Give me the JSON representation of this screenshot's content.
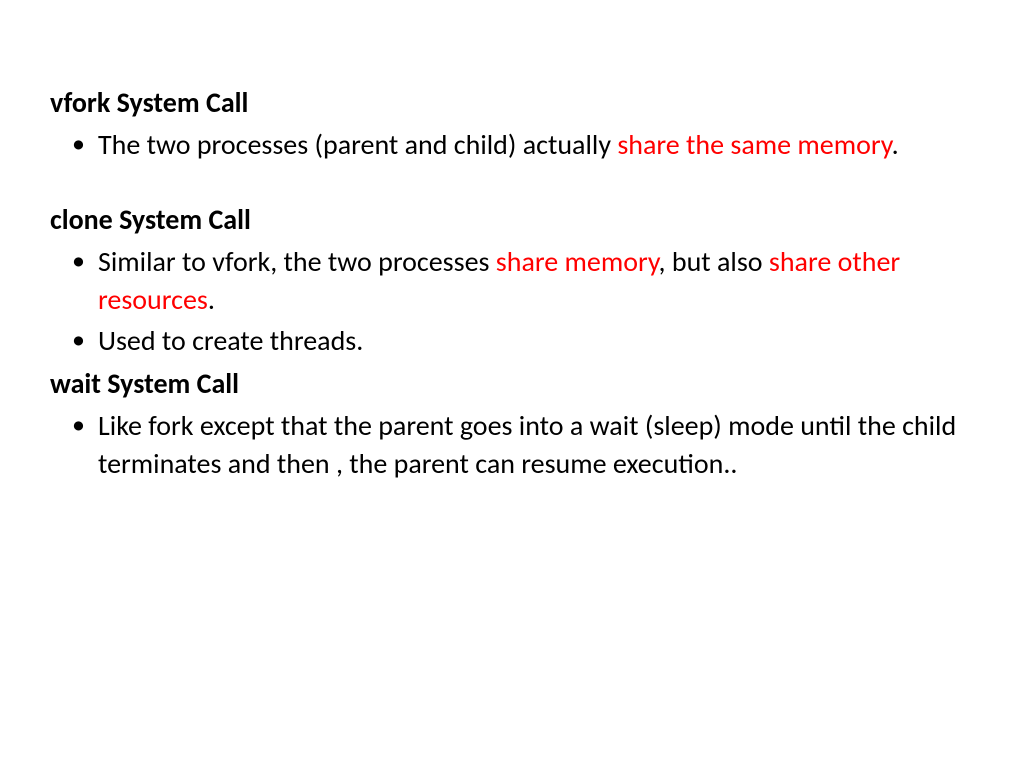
{
  "sections": {
    "vfork": {
      "heading": "vfork System Call",
      "bullet1": {
        "prefix": "The two processes (parent and child) actually ",
        "highlight": "share the same memory",
        "suffix": "."
      }
    },
    "clone": {
      "heading": "clone System Call",
      "bullet1": {
        "prefix": "Similar to vfork, the two processes ",
        "highlight1": "share memory",
        "middle": ", but also ",
        "highlight2": "share other resources",
        "suffix": "."
      },
      "bullet2": "Used to create threads."
    },
    "wait": {
      "heading": "wait System Call",
      "bullet1": " Like fork except that the parent goes into a wait (sleep) mode until the child terminates and then , the parent can resume execution.."
    }
  }
}
